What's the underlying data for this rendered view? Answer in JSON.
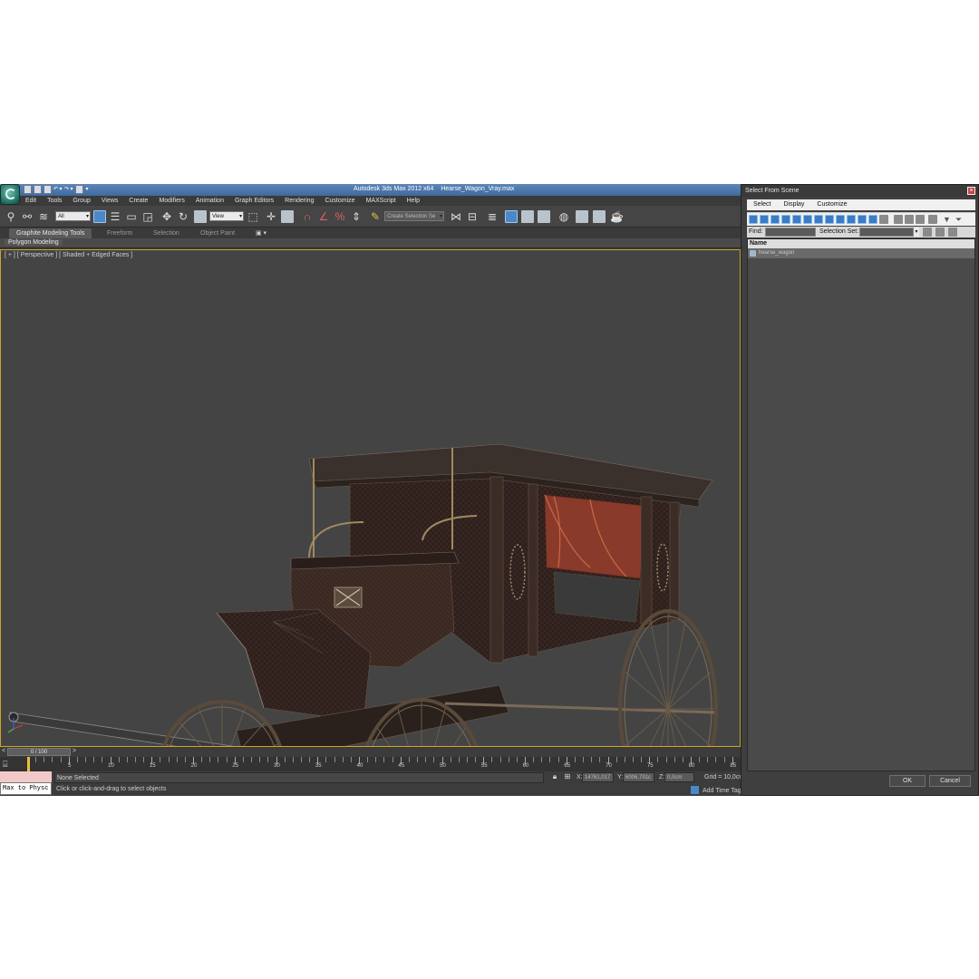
{
  "window": {
    "title": "Autodesk 3ds Max 2012 x64",
    "file": "Hearse_Wagon_Vray.max"
  },
  "menubar": [
    "Edit",
    "Tools",
    "Group",
    "Views",
    "Create",
    "Modifiers",
    "Animation",
    "Graph Editors",
    "Rendering",
    "Customize",
    "MAXScript",
    "Help"
  ],
  "toolbar": {
    "selection_filter": "All",
    "reference_coord": "View",
    "named_selection_placeholder": "Create Selection Se"
  },
  "ribbon": {
    "tabs": [
      "Graphite Modeling Tools",
      "Freeform",
      "Selection",
      "Object Paint"
    ],
    "panel_label": "Polygon Modeling"
  },
  "viewport": {
    "label": "[ + ] [ Perspective ] [ Shaded + Edged Faces ]",
    "scene_object": "hearse_wagon"
  },
  "timeline": {
    "frame_display": "0 / 100",
    "ruler_labels": [
      "5",
      "10",
      "15",
      "20",
      "25",
      "30",
      "35",
      "40",
      "45",
      "50",
      "55",
      "60",
      "65",
      "70",
      "75",
      "80",
      "85"
    ]
  },
  "status": {
    "maxscript_label": "Max to Physc",
    "selection_status": "None Selected",
    "prompt": "Click or click-and-drag to select objects",
    "x_label": "X:",
    "x_value": "14761,017",
    "y_label": "Y:",
    "y_value": "6006,791c",
    "z_label": "Z:",
    "z_value": "0,0cm",
    "grid": "Grid = 10,0cm",
    "add_time_tag": "Add Time Tag"
  },
  "dialog": {
    "title": "Select From Scene",
    "menu": [
      "Select",
      "Display",
      "Customize"
    ],
    "find_label": "Find:",
    "selection_set_label": "Selection Set:",
    "list_header": "Name",
    "items": [
      "hearse_wagon"
    ],
    "ok": "OK",
    "cancel": "Cancel"
  },
  "colors": {
    "viewport_bg": "#444444",
    "active_border": "#c9a62a",
    "title_blue": "#4f79ad",
    "accent_blue": "#4a88c8"
  }
}
